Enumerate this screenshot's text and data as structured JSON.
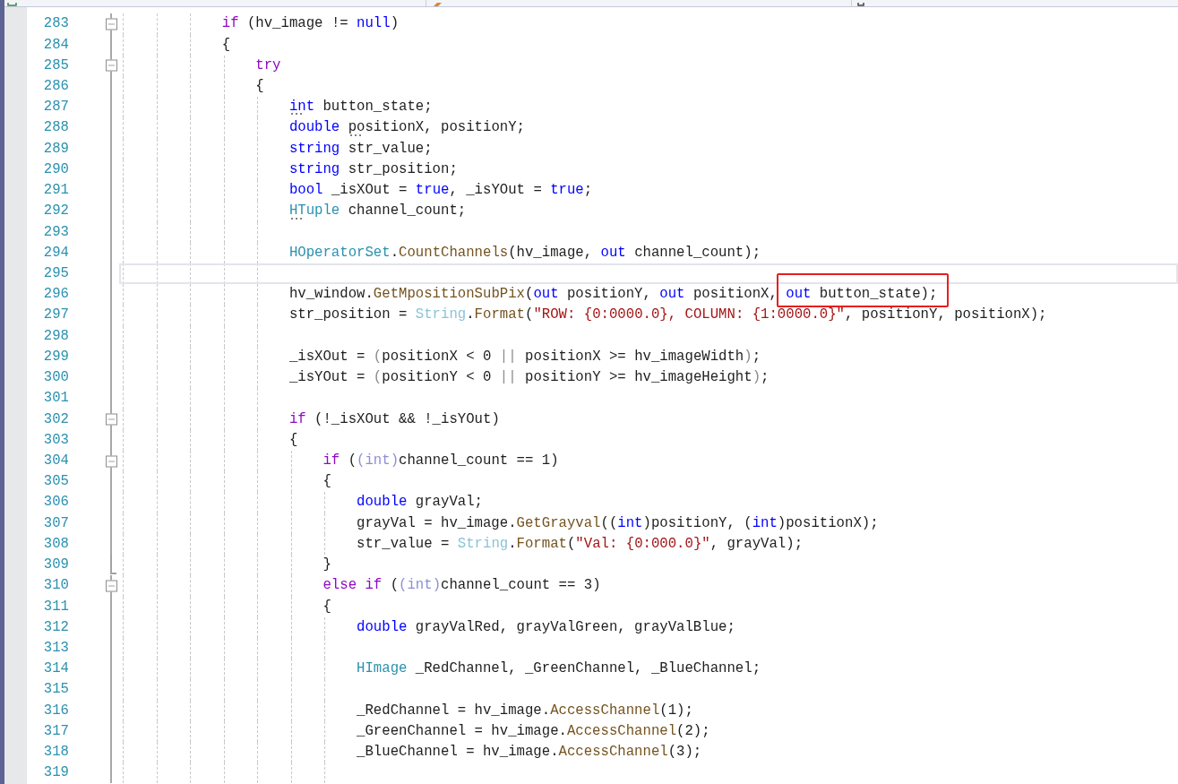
{
  "code_lines": [
    {
      "number": "283",
      "expanded": true,
      "tokens": [
        {
          "kind": "control",
          "text": "if"
        },
        {
          "kind": "plain",
          "text": " (hv_image != "
        },
        {
          "kind": "keyword",
          "text": "null"
        },
        {
          "kind": "plain",
          "text": ")"
        }
      ]
    },
    {
      "number": "284",
      "tokens": [
        {
          "kind": "plain",
          "text": "{"
        }
      ],
      "children": [
        {
          "number": "285",
          "expanded": true,
          "tokens": [
            {
              "kind": "control",
              "text": "try"
            }
          ]
        },
        {
          "number": "286",
          "tokens": [
            {
              "kind": "plain",
              "text": "{"
            }
          ],
          "children": [
            {
              "number": "287",
              "tokens": [
                {
                  "kind": "keyword",
                  "text": "int",
                  "hint": true
                },
                {
                  "kind": "plain",
                  "text": " button_state;"
                }
              ]
            },
            {
              "number": "288",
              "tokens": [
                {
                  "kind": "keyword",
                  "text": "double "
                },
                {
                  "kind": "plain",
                  "text": "positionX",
                  "hint": true
                },
                {
                  "kind": "plain",
                  "text": ", positionY;"
                }
              ]
            },
            {
              "number": "289",
              "tokens": [
                {
                  "kind": "keyword",
                  "text": "string"
                },
                {
                  "kind": "plain",
                  "text": " str_value;"
                }
              ]
            },
            {
              "number": "290",
              "tokens": [
                {
                  "kind": "keyword",
                  "text": "string"
                },
                {
                  "kind": "plain",
                  "text": " str_position;"
                }
              ]
            },
            {
              "number": "291",
              "tokens": [
                {
                  "kind": "keyword",
                  "text": "bool"
                },
                {
                  "kind": "plain",
                  "text": " _isXOut = "
                },
                {
                  "kind": "keyword",
                  "text": "true"
                },
                {
                  "kind": "plain",
                  "text": ", _isYOut = "
                },
                {
                  "kind": "keyword",
                  "text": "true"
                },
                {
                  "kind": "plain",
                  "text": ";"
                }
              ]
            },
            {
              "number": "292",
              "tokens": [
                {
                  "kind": "type",
                  "text": "HTuple",
                  "hint": true
                },
                {
                  "kind": "plain",
                  "text": " channel_count;"
                }
              ]
            },
            {
              "number": "293"
            },
            {
              "number": "294",
              "tokens": [
                {
                  "kind": "type",
                  "text": "HOperatorSet"
                },
                {
                  "kind": "plain",
                  "text": "."
                },
                {
                  "kind": "method",
                  "text": "CountChannels"
                },
                {
                  "kind": "plain",
                  "text": "(hv_image, "
                },
                {
                  "kind": "keyword",
                  "text": "out"
                },
                {
                  "kind": "plain",
                  "text": " channel_count);"
                }
              ]
            },
            {
              "number": "295",
              "current": true
            },
            {
              "number": "296",
              "tokens": [
                {
                  "kind": "plain",
                  "text": "hv_window."
                },
                {
                  "kind": "method",
                  "text": "GetMpositionSubPix"
                },
                {
                  "kind": "plain",
                  "text": "("
                },
                {
                  "kind": "keyword",
                  "text": "out"
                },
                {
                  "kind": "plain",
                  "text": " positionY, "
                },
                {
                  "kind": "keyword",
                  "text": "out"
                },
                {
                  "kind": "plain",
                  "text": " positionX, "
                },
                {
                  "kind": "keyword",
                  "text": "out",
                  "boxed": true
                },
                {
                  "kind": "plain",
                  "text": " button_state);",
                  "boxed": true
                }
              ]
            },
            {
              "number": "297",
              "tokens": [
                {
                  "kind": "plain",
                  "text": "str_position = "
                },
                {
                  "kind": "faded_type",
                  "text": "String"
                },
                {
                  "kind": "plain",
                  "text": "."
                },
                {
                  "kind": "method",
                  "text": "Format"
                },
                {
                  "kind": "plain",
                  "text": "("
                },
                {
                  "kind": "string",
                  "text": "\"ROW: {0:0000.0}, COLUMN: {1:0000.0}\""
                },
                {
                  "kind": "plain",
                  "text": ", positionY, positionX);"
                }
              ]
            },
            {
              "number": "298"
            },
            {
              "number": "299",
              "tokens": [
                {
                  "kind": "plain",
                  "text": "_isXOut = "
                },
                {
                  "kind": "faded",
                  "text": "("
                },
                {
                  "kind": "plain",
                  "text": "positionX < 0 "
                },
                {
                  "kind": "faded",
                  "text": "||"
                },
                {
                  "kind": "plain",
                  "text": " positionX >= hv_imageWidth"
                },
                {
                  "kind": "faded",
                  "text": ")"
                },
                {
                  "kind": "plain",
                  "text": ";"
                }
              ]
            },
            {
              "number": "300",
              "tokens": [
                {
                  "kind": "plain",
                  "text": "_isYOut = "
                },
                {
                  "kind": "faded",
                  "text": "("
                },
                {
                  "kind": "plain",
                  "text": "positionY < 0 "
                },
                {
                  "kind": "faded",
                  "text": "||"
                },
                {
                  "kind": "plain",
                  "text": " positionY >= hv_imageHeight"
                },
                {
                  "kind": "faded",
                  "text": ")"
                },
                {
                  "kind": "plain",
                  "text": ";"
                }
              ]
            },
            {
              "number": "301"
            },
            {
              "number": "302",
              "expanded": true,
              "tokens": [
                {
                  "kind": "control",
                  "text": "if"
                },
                {
                  "kind": "plain",
                  "text": " (!_isXOut && !_isYOut)"
                }
              ]
            },
            {
              "number": "303",
              "tokens": [
                {
                  "kind": "plain",
                  "text": "{"
                }
              ],
              "children": [
                {
                  "number": "304",
                  "expanded": true,
                  "tokens": [
                    {
                      "kind": "control",
                      "text": "if"
                    },
                    {
                      "kind": "plain",
                      "text": " ("
                    },
                    {
                      "kind": "cast",
                      "text": "(int)"
                    },
                    {
                      "kind": "plain",
                      "text": "channel_count == 1)"
                    }
                  ]
                },
                {
                  "number": "305",
                  "tokens": [
                    {
                      "kind": "plain",
                      "text": "{"
                    }
                  ],
                  "children": [
                    {
                      "number": "306",
                      "tokens": [
                        {
                          "kind": "keyword",
                          "text": "double"
                        },
                        {
                          "kind": "plain",
                          "text": " grayVal;"
                        }
                      ]
                    },
                    {
                      "number": "307",
                      "tokens": [
                        {
                          "kind": "plain",
                          "text": "grayVal = hv_image."
                        },
                        {
                          "kind": "method",
                          "text": "GetGrayval"
                        },
                        {
                          "kind": "plain",
                          "text": "(("
                        },
                        {
                          "kind": "keyword",
                          "text": "int"
                        },
                        {
                          "kind": "plain",
                          "text": ")positionY, ("
                        },
                        {
                          "kind": "keyword",
                          "text": "int"
                        },
                        {
                          "kind": "plain",
                          "text": ")positionX);"
                        }
                      ]
                    },
                    {
                      "number": "308",
                      "tokens": [
                        {
                          "kind": "plain",
                          "text": "str_value = "
                        },
                        {
                          "kind": "faded_type",
                          "text": "String"
                        },
                        {
                          "kind": "plain",
                          "text": "."
                        },
                        {
                          "kind": "method",
                          "text": "Format"
                        },
                        {
                          "kind": "plain",
                          "text": "("
                        },
                        {
                          "kind": "string",
                          "text": "\"Val: {0:000.0}\""
                        },
                        {
                          "kind": "plain",
                          "text": ", grayVal);"
                        }
                      ]
                    }
                  ]
                },
                {
                  "number": "309",
                  "fold_end": true,
                  "tokens": [
                    {
                      "kind": "plain",
                      "text": "}"
                    }
                  ]
                },
                {
                  "number": "310",
                  "expanded": true,
                  "tokens": [
                    {
                      "kind": "control",
                      "text": "else if"
                    },
                    {
                      "kind": "plain",
                      "text": " ("
                    },
                    {
                      "kind": "cast",
                      "text": "(int)"
                    },
                    {
                      "kind": "plain",
                      "text": "channel_count == 3)"
                    }
                  ]
                },
                {
                  "number": "311",
                  "tokens": [
                    {
                      "kind": "plain",
                      "text": "{"
                    }
                  ],
                  "children": [
                    {
                      "number": "312",
                      "tokens": [
                        {
                          "kind": "keyword",
                          "text": "double"
                        },
                        {
                          "kind": "plain",
                          "text": " grayValRed, grayValGreen, grayValBlue;"
                        }
                      ]
                    },
                    {
                      "number": "313"
                    },
                    {
                      "number": "314",
                      "tokens": [
                        {
                          "kind": "type",
                          "text": "HImage"
                        },
                        {
                          "kind": "plain",
                          "text": " _RedChannel, _GreenChannel, _BlueChannel;"
                        }
                      ]
                    },
                    {
                      "number": "315"
                    },
                    {
                      "number": "316",
                      "tokens": [
                        {
                          "kind": "plain",
                          "text": "_RedChannel = hv_image."
                        },
                        {
                          "kind": "method",
                          "text": "AccessChannel"
                        },
                        {
                          "kind": "plain",
                          "text": "(1);"
                        }
                      ]
                    },
                    {
                      "number": "317",
                      "tokens": [
                        {
                          "kind": "plain",
                          "text": "_GreenChannel = hv_image."
                        },
                        {
                          "kind": "method",
                          "text": "AccessChannel"
                        },
                        {
                          "kind": "plain",
                          "text": "(2);"
                        }
                      ]
                    },
                    {
                      "number": "318",
                      "tokens": [
                        {
                          "kind": "plain",
                          "text": "_BlueChannel = hv_image."
                        },
                        {
                          "kind": "method",
                          "text": "AccessChannel"
                        },
                        {
                          "kind": "plain",
                          "text": "(3);"
                        }
                      ]
                    },
                    {
                      "number": "319"
                    }
                  ]
                }
              ]
            }
          ]
        }
      ]
    }
  ]
}
